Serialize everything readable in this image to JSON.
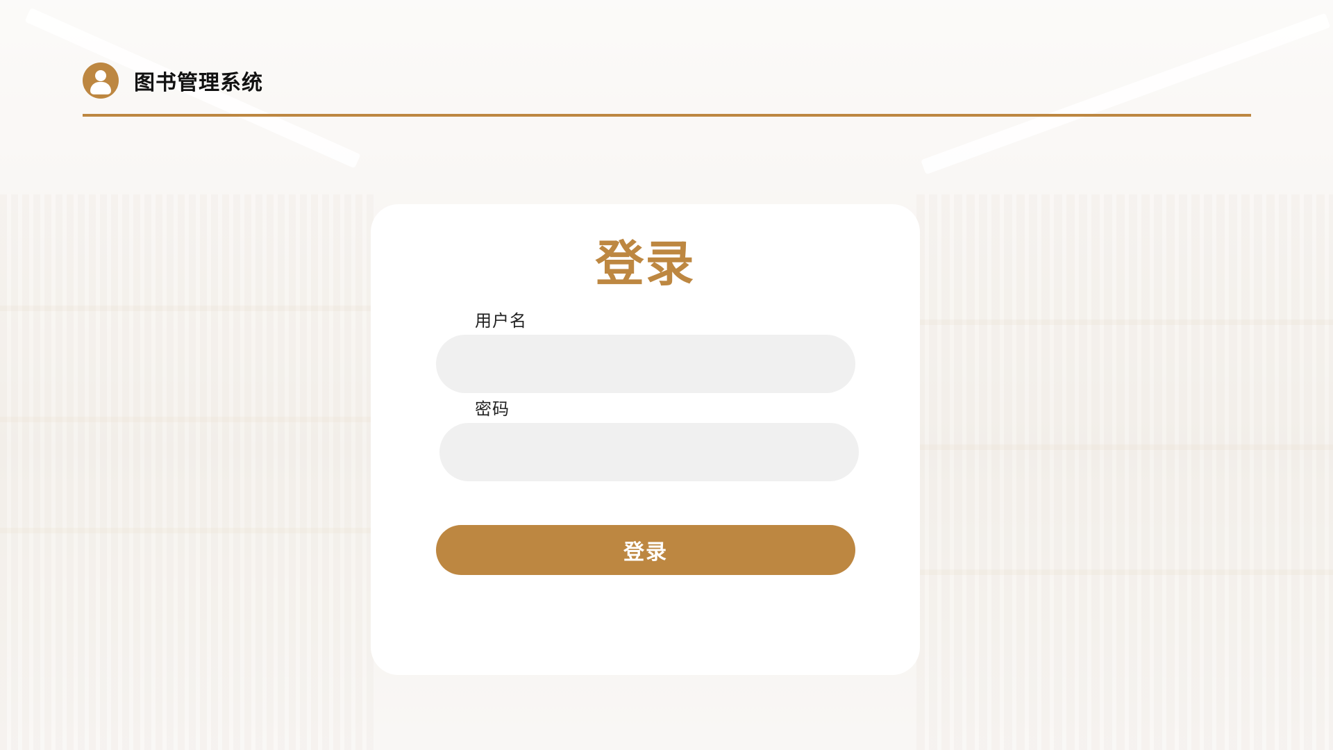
{
  "header": {
    "app_title": "图书管理系统",
    "avatar_icon": "user-icon"
  },
  "colors": {
    "accent": "#bd8741",
    "input_bg": "#f0f0f0",
    "card_bg": "#ffffff"
  },
  "login": {
    "title": "登录",
    "username_label": "用户名",
    "username_value": "",
    "password_label": "密码",
    "password_value": "",
    "submit_label": "登录"
  }
}
